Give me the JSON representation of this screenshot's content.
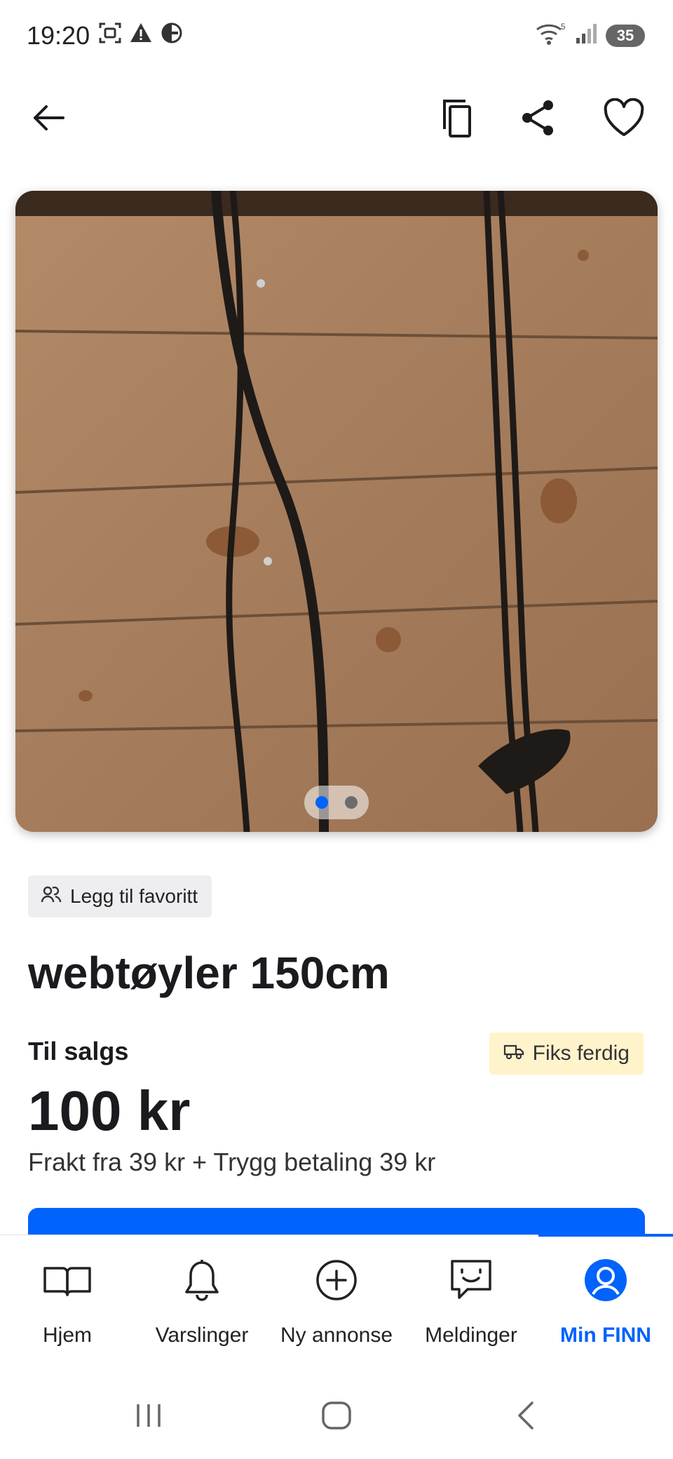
{
  "status_bar": {
    "time": "19:20",
    "battery": "35",
    "left_icons": [
      "screenshot-icon",
      "warning-icon",
      "data-saver-icon"
    ],
    "right_icons": [
      "wifi-icon",
      "signal-icon",
      "battery-icon"
    ]
  },
  "top_bar": {
    "icons": [
      "back-arrow-icon",
      "copy-icon",
      "share-icon",
      "heart-icon"
    ]
  },
  "gallery": {
    "image_description": "Black web reins hanging on a wooden plank wall",
    "current_index": 1,
    "total": 2
  },
  "listing": {
    "favorite_chip": "Legg til favoritt",
    "title": "webtøyler 150cm",
    "status": "Til salgs",
    "badge": "Fiks ferdig",
    "price": "100 kr",
    "shipping": "Frakt fra 39 kr + Trygg betaling 39 kr"
  },
  "colors": {
    "accent": "#0063fb",
    "badge_bg": "#fff3cc",
    "chip_bg": "#eeeef0"
  },
  "bottom_nav": {
    "items": [
      {
        "label": "Hjem",
        "icon": "book-icon"
      },
      {
        "label": "Varslinger",
        "icon": "bell-icon"
      },
      {
        "label": "Ny annonse",
        "icon": "plus-circle-icon"
      },
      {
        "label": "Meldinger",
        "icon": "chat-icon"
      },
      {
        "label": "Min FINN",
        "icon": "profile-icon",
        "active": true
      }
    ]
  },
  "system_nav": {
    "icons": [
      "recent-apps-icon",
      "home-icon",
      "back-icon"
    ]
  }
}
